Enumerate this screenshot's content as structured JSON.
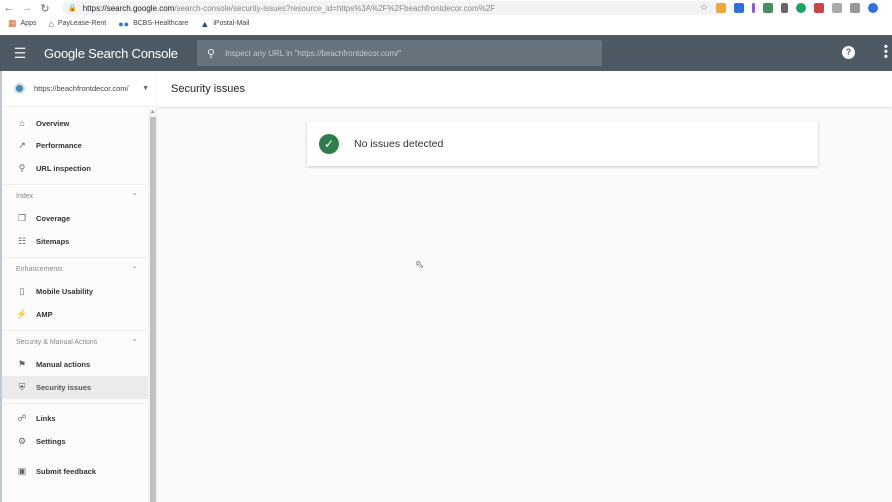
{
  "browser": {
    "url_host": "https://search.google.com",
    "url_path": "/search-console/security-issues?resource_id=https%3A%2F%2Fbeachfrontdecor.com%2F",
    "bookmarks": [
      {
        "label": "Apps",
        "icon": "apps-grid-icon"
      },
      {
        "label": "PayLease-Rent",
        "icon": "house-icon"
      },
      {
        "label": "BCBS-Healthcare",
        "icon": "bcbs-icon"
      },
      {
        "label": "iPostal-Mail",
        "icon": "ipostal-icon"
      }
    ]
  },
  "appbar": {
    "title": "Google Search Console",
    "search_placeholder": "Inspect any URL in \"https://beachfrontdecor.com/\""
  },
  "sidebar": {
    "property": "https://beachfrontdecor.com/",
    "items_top": [
      {
        "label": "Overview",
        "icon": "home-icon"
      },
      {
        "label": "Performance",
        "icon": "trending-up-icon"
      },
      {
        "label": "URL inspection",
        "icon": "search-icon"
      }
    ],
    "sections": [
      {
        "title": "Index",
        "items": [
          {
            "label": "Coverage",
            "icon": "file-copy-icon"
          },
          {
            "label": "Sitemaps",
            "icon": "sitemap-icon"
          }
        ]
      },
      {
        "title": "Enhancements",
        "items": [
          {
            "label": "Mobile Usability",
            "icon": "phone-icon"
          },
          {
            "label": "AMP",
            "icon": "bolt-icon"
          }
        ]
      },
      {
        "title": "Security & Manual Actions",
        "items": [
          {
            "label": "Manual actions",
            "icon": "flag-icon"
          },
          {
            "label": "Security issues",
            "icon": "shield-icon"
          }
        ]
      }
    ],
    "items_bottom": [
      {
        "label": "Links",
        "icon": "links-icon"
      },
      {
        "label": "Settings",
        "icon": "gear-icon"
      }
    ],
    "feedback": {
      "label": "Submit feedback",
      "icon": "feedback-icon"
    }
  },
  "main": {
    "title": "Security issues",
    "status": "No issues detected"
  }
}
